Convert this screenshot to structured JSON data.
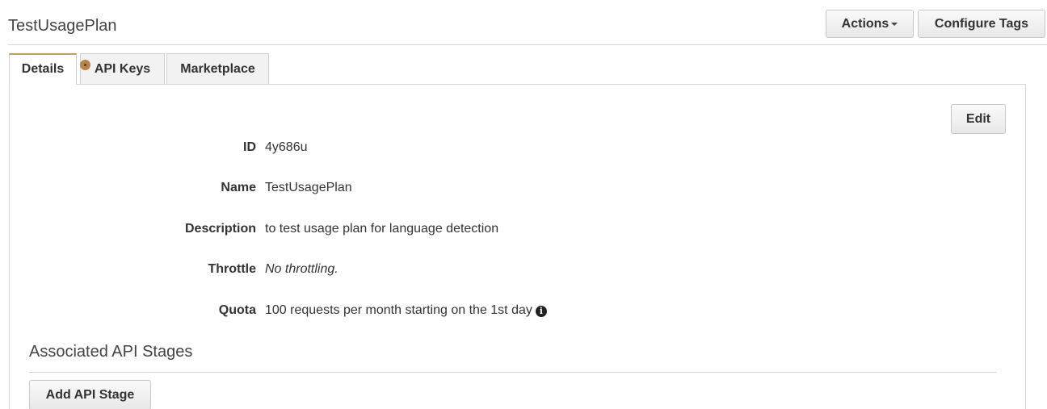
{
  "header": {
    "title": "TestUsagePlan",
    "actions_label": "Actions",
    "configure_tags_label": "Configure Tags"
  },
  "tabs": [
    {
      "label": "Details",
      "active": true
    },
    {
      "label": "API Keys",
      "active": false
    },
    {
      "label": "Marketplace",
      "active": false
    }
  ],
  "details": {
    "edit_label": "Edit",
    "fields": [
      {
        "label": "ID",
        "value": "4y686u"
      },
      {
        "label": "Name",
        "value": "TestUsagePlan"
      },
      {
        "label": "Description",
        "value": "to test usage plan for language detection"
      },
      {
        "label": "Throttle",
        "value": "No throttling."
      },
      {
        "label": "Quota",
        "value": "100 requests per month starting on the 1st day",
        "icon": "info-icon"
      }
    ]
  },
  "stages": {
    "title": "Associated API Stages",
    "add_label": "Add API Stage"
  },
  "colors": {
    "active_tab_accent": "#c49a6c",
    "badge": "#b8834f"
  }
}
